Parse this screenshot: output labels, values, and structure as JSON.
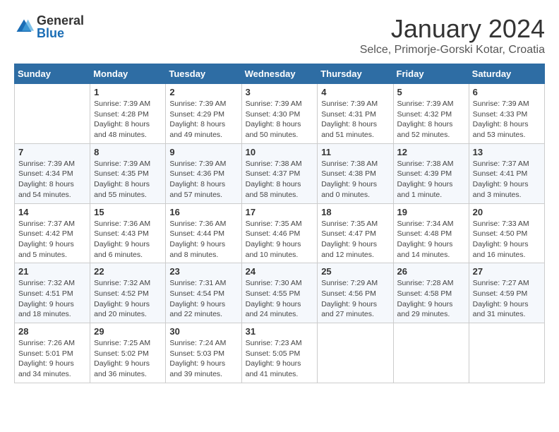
{
  "logo": {
    "general": "General",
    "blue": "Blue"
  },
  "title": {
    "month": "January 2024",
    "location": "Selce, Primorje-Gorski Kotar, Croatia"
  },
  "days_of_week": [
    "Sunday",
    "Monday",
    "Tuesday",
    "Wednesday",
    "Thursday",
    "Friday",
    "Saturday"
  ],
  "weeks": [
    [
      {
        "day": "",
        "info": ""
      },
      {
        "day": "1",
        "info": "Sunrise: 7:39 AM\nSunset: 4:28 PM\nDaylight: 8 hours\nand 48 minutes."
      },
      {
        "day": "2",
        "info": "Sunrise: 7:39 AM\nSunset: 4:29 PM\nDaylight: 8 hours\nand 49 minutes."
      },
      {
        "day": "3",
        "info": "Sunrise: 7:39 AM\nSunset: 4:30 PM\nDaylight: 8 hours\nand 50 minutes."
      },
      {
        "day": "4",
        "info": "Sunrise: 7:39 AM\nSunset: 4:31 PM\nDaylight: 8 hours\nand 51 minutes."
      },
      {
        "day": "5",
        "info": "Sunrise: 7:39 AM\nSunset: 4:32 PM\nDaylight: 8 hours\nand 52 minutes."
      },
      {
        "day": "6",
        "info": "Sunrise: 7:39 AM\nSunset: 4:33 PM\nDaylight: 8 hours\nand 53 minutes."
      }
    ],
    [
      {
        "day": "7",
        "info": "Sunrise: 7:39 AM\nSunset: 4:34 PM\nDaylight: 8 hours\nand 54 minutes."
      },
      {
        "day": "8",
        "info": "Sunrise: 7:39 AM\nSunset: 4:35 PM\nDaylight: 8 hours\nand 55 minutes."
      },
      {
        "day": "9",
        "info": "Sunrise: 7:39 AM\nSunset: 4:36 PM\nDaylight: 8 hours\nand 57 minutes."
      },
      {
        "day": "10",
        "info": "Sunrise: 7:38 AM\nSunset: 4:37 PM\nDaylight: 8 hours\nand 58 minutes."
      },
      {
        "day": "11",
        "info": "Sunrise: 7:38 AM\nSunset: 4:38 PM\nDaylight: 9 hours\nand 0 minutes."
      },
      {
        "day": "12",
        "info": "Sunrise: 7:38 AM\nSunset: 4:39 PM\nDaylight: 9 hours\nand 1 minute."
      },
      {
        "day": "13",
        "info": "Sunrise: 7:37 AM\nSunset: 4:41 PM\nDaylight: 9 hours\nand 3 minutes."
      }
    ],
    [
      {
        "day": "14",
        "info": "Sunrise: 7:37 AM\nSunset: 4:42 PM\nDaylight: 9 hours\nand 5 minutes."
      },
      {
        "day": "15",
        "info": "Sunrise: 7:36 AM\nSunset: 4:43 PM\nDaylight: 9 hours\nand 6 minutes."
      },
      {
        "day": "16",
        "info": "Sunrise: 7:36 AM\nSunset: 4:44 PM\nDaylight: 9 hours\nand 8 minutes."
      },
      {
        "day": "17",
        "info": "Sunrise: 7:35 AM\nSunset: 4:46 PM\nDaylight: 9 hours\nand 10 minutes."
      },
      {
        "day": "18",
        "info": "Sunrise: 7:35 AM\nSunset: 4:47 PM\nDaylight: 9 hours\nand 12 minutes."
      },
      {
        "day": "19",
        "info": "Sunrise: 7:34 AM\nSunset: 4:48 PM\nDaylight: 9 hours\nand 14 minutes."
      },
      {
        "day": "20",
        "info": "Sunrise: 7:33 AM\nSunset: 4:50 PM\nDaylight: 9 hours\nand 16 minutes."
      }
    ],
    [
      {
        "day": "21",
        "info": "Sunrise: 7:32 AM\nSunset: 4:51 PM\nDaylight: 9 hours\nand 18 minutes."
      },
      {
        "day": "22",
        "info": "Sunrise: 7:32 AM\nSunset: 4:52 PM\nDaylight: 9 hours\nand 20 minutes."
      },
      {
        "day": "23",
        "info": "Sunrise: 7:31 AM\nSunset: 4:54 PM\nDaylight: 9 hours\nand 22 minutes."
      },
      {
        "day": "24",
        "info": "Sunrise: 7:30 AM\nSunset: 4:55 PM\nDaylight: 9 hours\nand 24 minutes."
      },
      {
        "day": "25",
        "info": "Sunrise: 7:29 AM\nSunset: 4:56 PM\nDaylight: 9 hours\nand 27 minutes."
      },
      {
        "day": "26",
        "info": "Sunrise: 7:28 AM\nSunset: 4:58 PM\nDaylight: 9 hours\nand 29 minutes."
      },
      {
        "day": "27",
        "info": "Sunrise: 7:27 AM\nSunset: 4:59 PM\nDaylight: 9 hours\nand 31 minutes."
      }
    ],
    [
      {
        "day": "28",
        "info": "Sunrise: 7:26 AM\nSunset: 5:01 PM\nDaylight: 9 hours\nand 34 minutes."
      },
      {
        "day": "29",
        "info": "Sunrise: 7:25 AM\nSunset: 5:02 PM\nDaylight: 9 hours\nand 36 minutes."
      },
      {
        "day": "30",
        "info": "Sunrise: 7:24 AM\nSunset: 5:03 PM\nDaylight: 9 hours\nand 39 minutes."
      },
      {
        "day": "31",
        "info": "Sunrise: 7:23 AM\nSunset: 5:05 PM\nDaylight: 9 hours\nand 41 minutes."
      },
      {
        "day": "",
        "info": ""
      },
      {
        "day": "",
        "info": ""
      },
      {
        "day": "",
        "info": ""
      }
    ]
  ]
}
